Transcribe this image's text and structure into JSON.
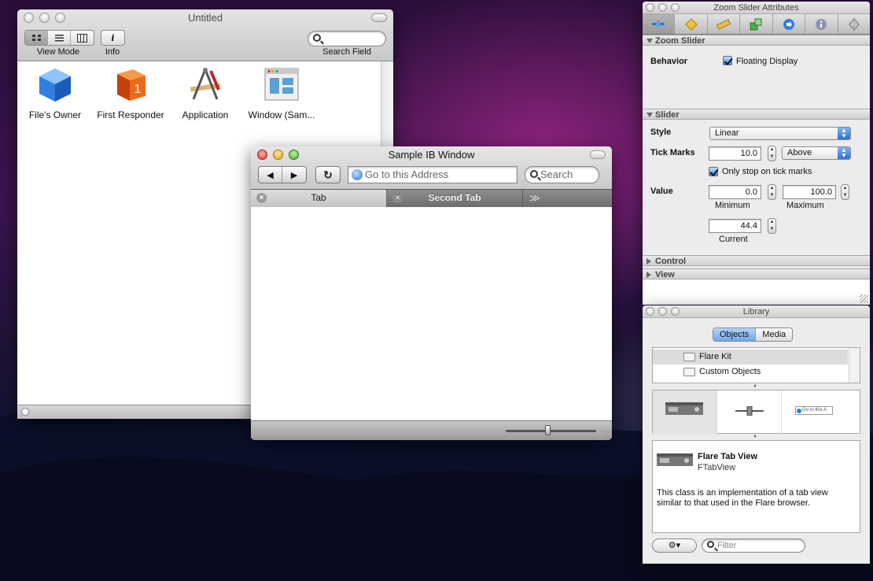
{
  "doc_window": {
    "title": "Untitled",
    "toolbar": {
      "view_mode_label": "View Mode",
      "info_label": "Info",
      "info_glyph": "i",
      "search_label": "Search Field",
      "search_placeholder": ""
    },
    "objects": [
      {
        "label": "File's Owner",
        "icon": "cube-icon"
      },
      {
        "label": "First Responder",
        "icon": "first-responder-icon"
      },
      {
        "label": "Application",
        "icon": "application-icon"
      },
      {
        "label": "Window (Sam...",
        "icon": "window-icon"
      }
    ]
  },
  "sample_window": {
    "title": "Sample IB Window",
    "back_glyph": "◀",
    "forward_glyph": "▶",
    "reload_glyph": "↻",
    "address_placeholder": "Go to this Address",
    "search_placeholder": "Search",
    "tabs": [
      {
        "label": "Tab",
        "close_glyph": "×"
      },
      {
        "label": "Second Tab",
        "close_glyph": "×"
      }
    ],
    "overflow_glyph": "≫"
  },
  "inspector": {
    "title": "Zoom Slider Attributes",
    "tab_icons": [
      "slider-attributes-icon",
      "effects-icon",
      "size-ruler-icon",
      "connections-icon",
      "bindings-icon",
      "info-icon",
      "applescript-icon"
    ],
    "sections": {
      "zoom_slider": "Zoom Slider",
      "slider": "Slider",
      "control": "Control",
      "view": "View"
    },
    "behavior_label": "Behavior",
    "floating_display_label": "Floating Display",
    "floating_display_checked": true,
    "style_label": "Style",
    "style_value": "Linear",
    "tick_marks_label": "Tick Marks",
    "tick_marks_value": "10.0",
    "tick_position_value": "Above",
    "only_stop_label": "Only stop on tick marks",
    "only_stop_checked": true,
    "value_label": "Value",
    "minimum_value": "0.0",
    "minimum_label": "Minimum",
    "maximum_value": "100.0",
    "maximum_label": "Maximum",
    "current_value": "44.4",
    "current_label": "Current"
  },
  "library": {
    "title": "Library",
    "segments": [
      "Objects",
      "Media"
    ],
    "selected_segment": "Objects",
    "groups": [
      "Flare Kit",
      "Custom Objects"
    ],
    "selected_group": "Flare Kit",
    "tiles": [
      "tab-view-tile",
      "slider-tile",
      "address-field-tile"
    ],
    "address_tile_text": "Go to this A",
    "detail": {
      "name": "Flare Tab View",
      "class": "FTabView",
      "description": "This class is an implementation of a tab view similar to that used in the Flare browser."
    },
    "filter_placeholder": "Filter",
    "gear_glyph": "⚙▾"
  }
}
